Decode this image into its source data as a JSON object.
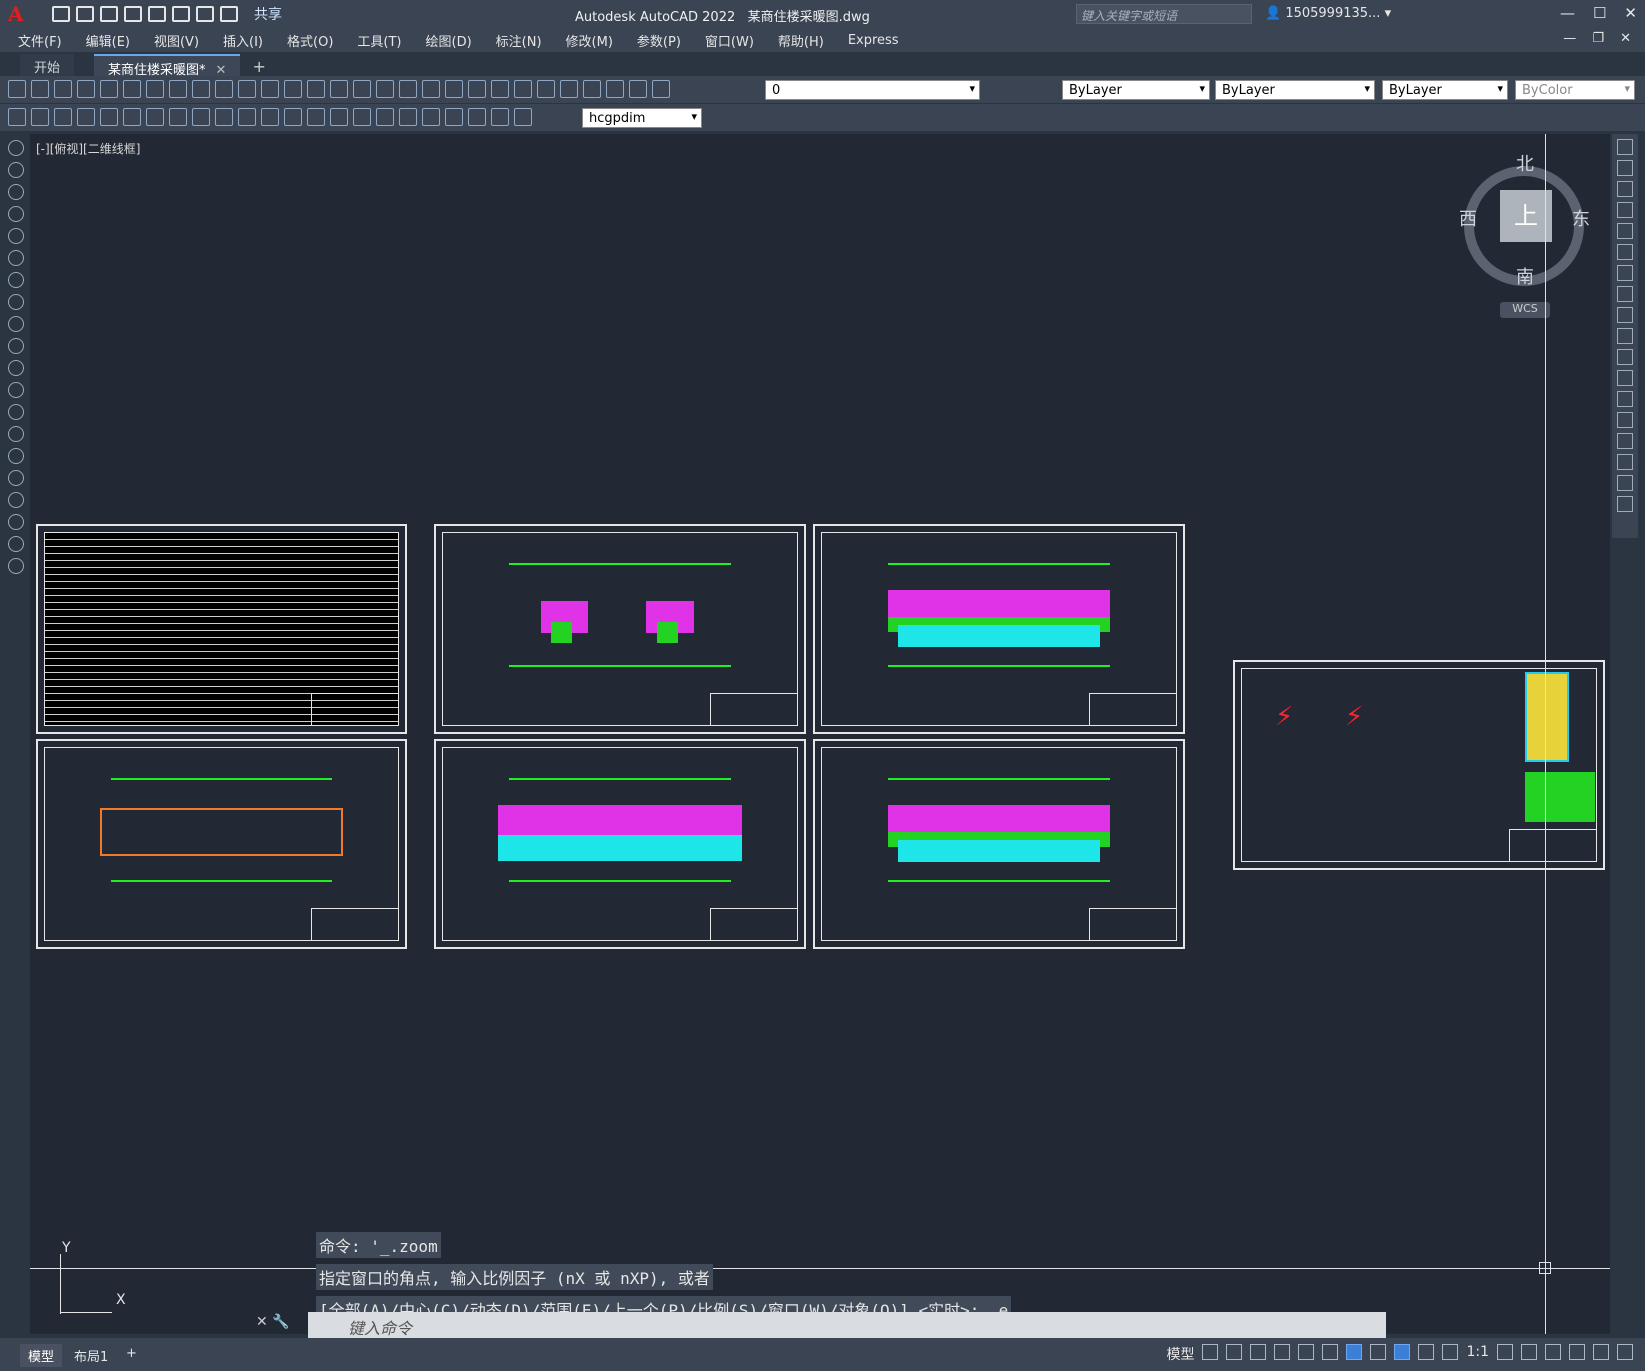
{
  "app": {
    "title": "Autodesk AutoCAD 2022",
    "document": "某商住楼采暖图.dwg",
    "logo": "A",
    "share": "共享",
    "search_placeholder": "键入关键字或短语",
    "user": "1505999135...",
    "window_controls": [
      "—",
      "☐",
      "✕"
    ]
  },
  "menu": [
    "文件(F)",
    "编辑(E)",
    "视图(V)",
    "插入(I)",
    "格式(O)",
    "工具(T)",
    "绘图(D)",
    "标注(N)",
    "修改(M)",
    "参数(P)",
    "窗口(W)",
    "帮助(H)",
    "Express"
  ],
  "tabs": {
    "start": "开始",
    "drawing": "某商住楼采暖图*",
    "close": "✕",
    "add": "+"
  },
  "props": {
    "layer": "0",
    "color": "ByLayer",
    "linetype": "ByLayer",
    "lineweight": "ByLayer",
    "plotstyle": "ByColor",
    "dimstyle": "hcgpdim"
  },
  "viewport": {
    "label": "[-][俯视][二维线框]",
    "compass": {
      "north": "北",
      "south": "南",
      "west": "西",
      "east": "东",
      "top": "上"
    },
    "wcs": "WCS"
  },
  "ucs": {
    "y": "Y",
    "x": "X"
  },
  "command": {
    "history": [
      "命令: '_.zoom",
      "指定窗口的角点, 输入比例因子 (nX 或 nXP), 或者",
      "[全部(A)/中心(C)/动态(D)/范围(E)/上一个(P)/比例(S)/窗口(W)/对象(O)] <实时>: _e"
    ],
    "placeholder": "键入命令"
  },
  "layouts": [
    "模型",
    "布局1"
  ],
  "status": {
    "model": "模型",
    "scale": "1:1"
  },
  "colors": {
    "background": "#222834",
    "ui": "#3b4453",
    "accent": "#3c7fd6",
    "green": "#24d224",
    "magenta": "#e032e6",
    "cyan": "#1ee5e8",
    "red": "#ff2233"
  },
  "icons": [
    "save-icon",
    "open-icon",
    "print-icon",
    "undo-icon",
    "redo-icon",
    "line-icon",
    "circle-icon",
    "move-icon",
    "rotate-icon",
    "grid-icon",
    "snap-icon"
  ]
}
